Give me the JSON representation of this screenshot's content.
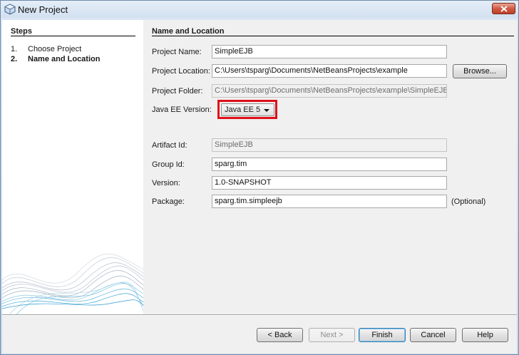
{
  "window": {
    "title": "New Project",
    "close_label": "×"
  },
  "steps": {
    "title": "Steps",
    "items": [
      {
        "num": "1.",
        "label": "Choose Project",
        "active": false
      },
      {
        "num": "2.",
        "label": "Name and Location",
        "active": true
      }
    ]
  },
  "section": {
    "title": "Name and Location"
  },
  "form": {
    "project_name": {
      "label": "Project Name:",
      "value": "SimpleEJB"
    },
    "project_location": {
      "label": "Project Location:",
      "value": "C:\\Users\\tsparg\\Documents\\NetBeansProjects\\example"
    },
    "browse_label": "Browse...",
    "project_folder": {
      "label": "Project Folder:",
      "value": "C:\\Users\\tsparg\\Documents\\NetBeansProjects\\example\\SimpleEJB"
    },
    "java_ee_version": {
      "label": "Java EE Version:",
      "value": "Java EE 5"
    },
    "artifact_id": {
      "label": "Artifact Id:",
      "value": "SimpleEJB"
    },
    "group_id": {
      "label": "Group Id:",
      "value": "sparg.tim"
    },
    "version": {
      "label": "Version:",
      "value": "1.0-SNAPSHOT"
    },
    "package": {
      "label": "Package:",
      "value": "sparg.tim.simpleejb",
      "optional": "(Optional)"
    }
  },
  "buttons": {
    "back": "< Back",
    "next": "Next >",
    "finish": "Finish",
    "cancel": "Cancel",
    "help": "Help"
  },
  "colors": {
    "highlight_border": "#e0101a",
    "accent": "#3c7fb1"
  }
}
